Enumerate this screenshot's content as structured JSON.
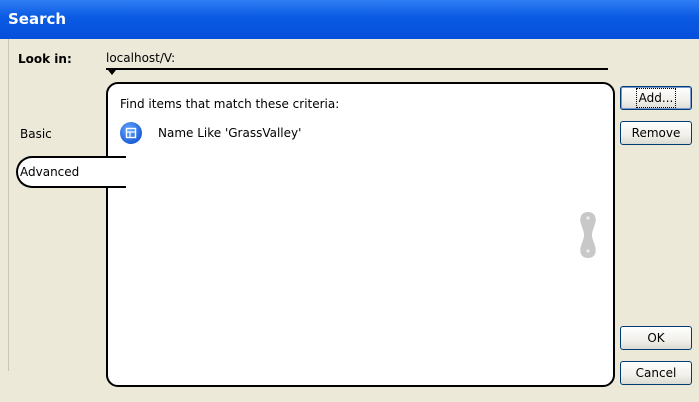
{
  "window": {
    "title": "Search"
  },
  "lookin": {
    "label": "Look in:",
    "value": "localhost/V:"
  },
  "tabs": [
    {
      "label": "Basic",
      "selected": false
    },
    {
      "label": "Advanced",
      "selected": true
    }
  ],
  "criteria": {
    "heading": "Find items that match these criteria:",
    "items": [
      {
        "text": "Name Like 'GrassValley'",
        "icon": "criterion-icon"
      }
    ]
  },
  "buttons": {
    "add": "Add...",
    "remove": "Remove",
    "ok": "OK",
    "cancel": "Cancel"
  },
  "colors": {
    "titlebar": "#0a5ae3",
    "dialog": "#ece9d8",
    "accent": "#1d5fd6"
  }
}
